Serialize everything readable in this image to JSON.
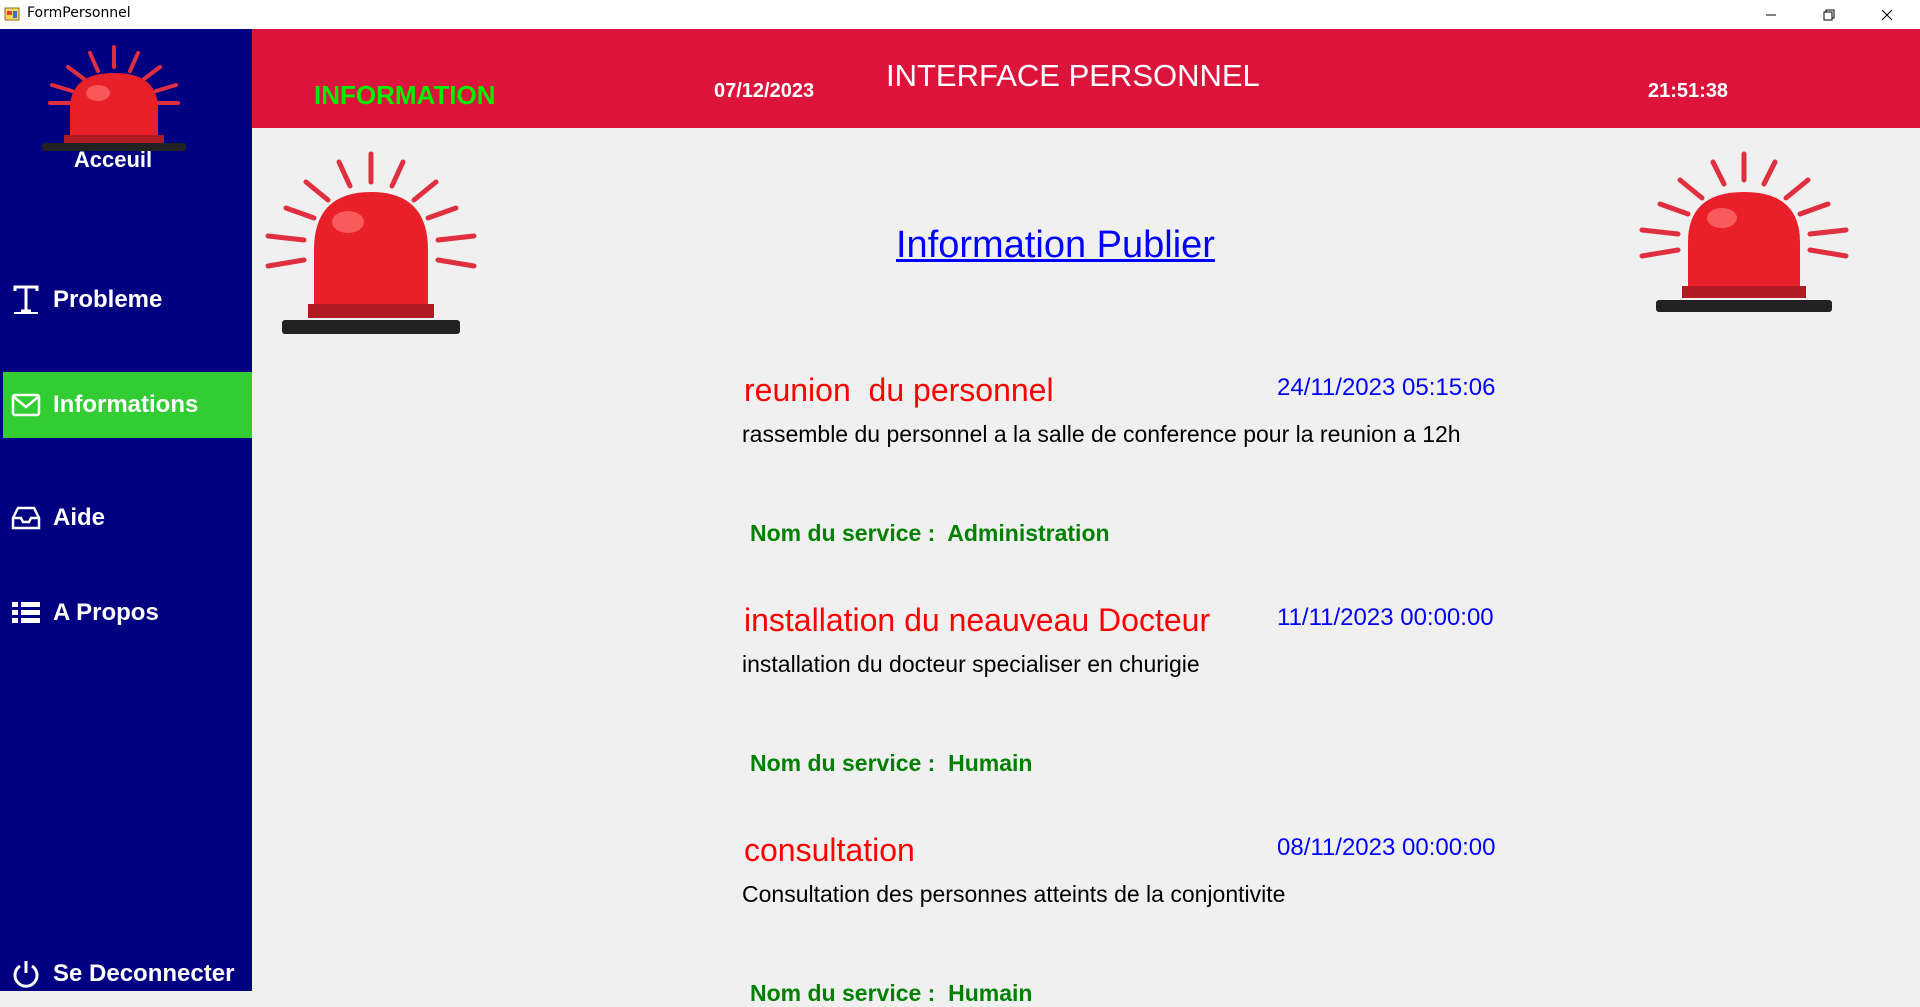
{
  "window": {
    "title": "FormPersonnel"
  },
  "sidebar": {
    "home_label": "Acceuil",
    "items": [
      {
        "label": "Probleme",
        "icon": "text-icon",
        "active": false
      },
      {
        "label": "Informations",
        "icon": "envelope-icon",
        "active": true
      },
      {
        "label": "Aide",
        "icon": "inbox-icon",
        "active": false
      },
      {
        "label": "A Propos",
        "icon": "list-icon",
        "active": false
      }
    ],
    "logout_label": "Se Deconnecter"
  },
  "header": {
    "section": "INFORMATION",
    "date": "07/12/2023",
    "title": "INTERFACE PERSONNEL",
    "time": "21:51:38"
  },
  "main": {
    "heading": "Information Publier",
    "infos": [
      {
        "title": "reunion  du personnel",
        "date": "24/11/2023 05:15:06",
        "description": "rassemble du personnel a la salle de conference pour la reunion a 12h",
        "service": "Nom du service :  Administration"
      },
      {
        "title": "installation du neauveau Docteur",
        "date": "11/11/2023 00:00:00",
        "description": "installation du docteur specialiser en churigie",
        "service": "Nom du service :  Humain"
      },
      {
        "title": "consultation",
        "date": "08/11/2023 00:00:00",
        "description": "Consultation des personnes atteints de la conjontivite",
        "service": "Nom du service :  Humain"
      }
    ]
  },
  "colors": {
    "sidebar_bg": "#000080",
    "header_bg": "#dc143c",
    "active_nav": "#32cd32",
    "info_title": "#ff0000",
    "info_date": "#0000ff",
    "service_text": "#008000"
  }
}
